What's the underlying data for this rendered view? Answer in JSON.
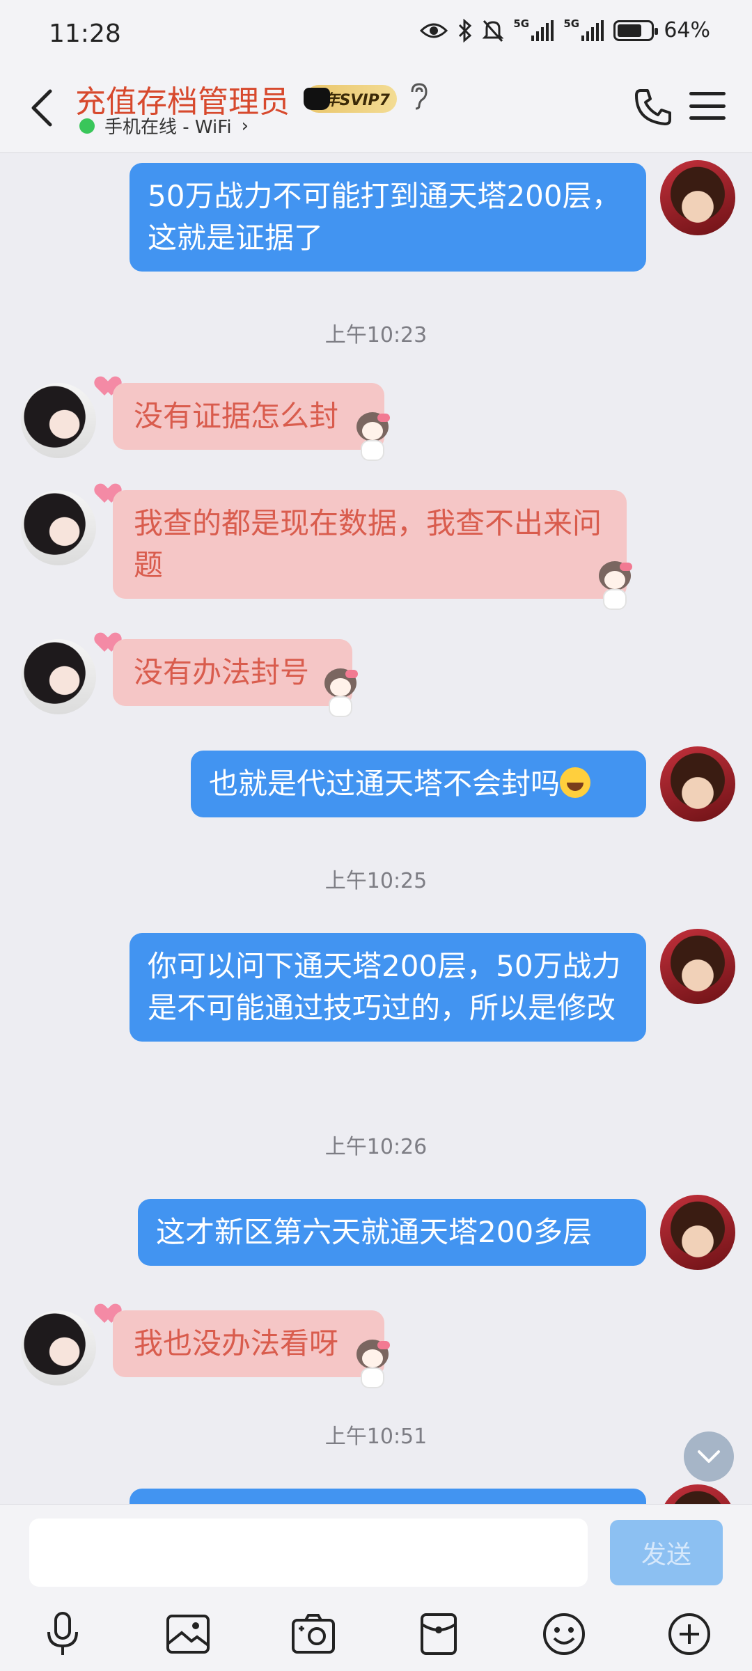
{
  "status_bar": {
    "time": "11:28",
    "network1": "5G",
    "network2": "5G",
    "battery": "64%"
  },
  "header": {
    "title": "充值存档管理员",
    "badge": "年SVIP7",
    "status": "手机在线 - WiFi",
    "status_chevron": "›"
  },
  "messages": [
    {
      "side": "right",
      "text": "50万战力不可能打到通天塔200层，这就是证据了"
    },
    {
      "type": "time",
      "text": "上午10:23"
    },
    {
      "side": "left",
      "text": "没有证据怎么封"
    },
    {
      "side": "left",
      "text": "我查的都是现在数据，我查不出来问题"
    },
    {
      "side": "left",
      "text": "没有办法封号"
    },
    {
      "side": "right",
      "text": "也就是代过通天塔不会封吗",
      "emoji": "laughing-tears"
    },
    {
      "type": "time",
      "text": "上午10:25"
    },
    {
      "side": "right",
      "text": "你可以问下通天塔200层，50万战力是不可能通过技巧过的，所以是修改"
    },
    {
      "type": "time",
      "text": "上午10:26"
    },
    {
      "side": "right",
      "text": "这才新区第六天就通天塔200多层"
    },
    {
      "side": "left",
      "text": "我也没办法看呀"
    },
    {
      "type": "time",
      "text": "上午10:51"
    }
  ],
  "input": {
    "value": "",
    "send_label": "发送"
  },
  "toolbar": [
    "microphone-icon",
    "image-icon",
    "camera-icon",
    "red-packet-icon",
    "emoji-icon",
    "plus-icon"
  ],
  "colors": {
    "my_bubble": "#4294f1",
    "their_bubble": "#f5c6c6",
    "their_text": "#d95c4d",
    "title": "#d7492d"
  }
}
